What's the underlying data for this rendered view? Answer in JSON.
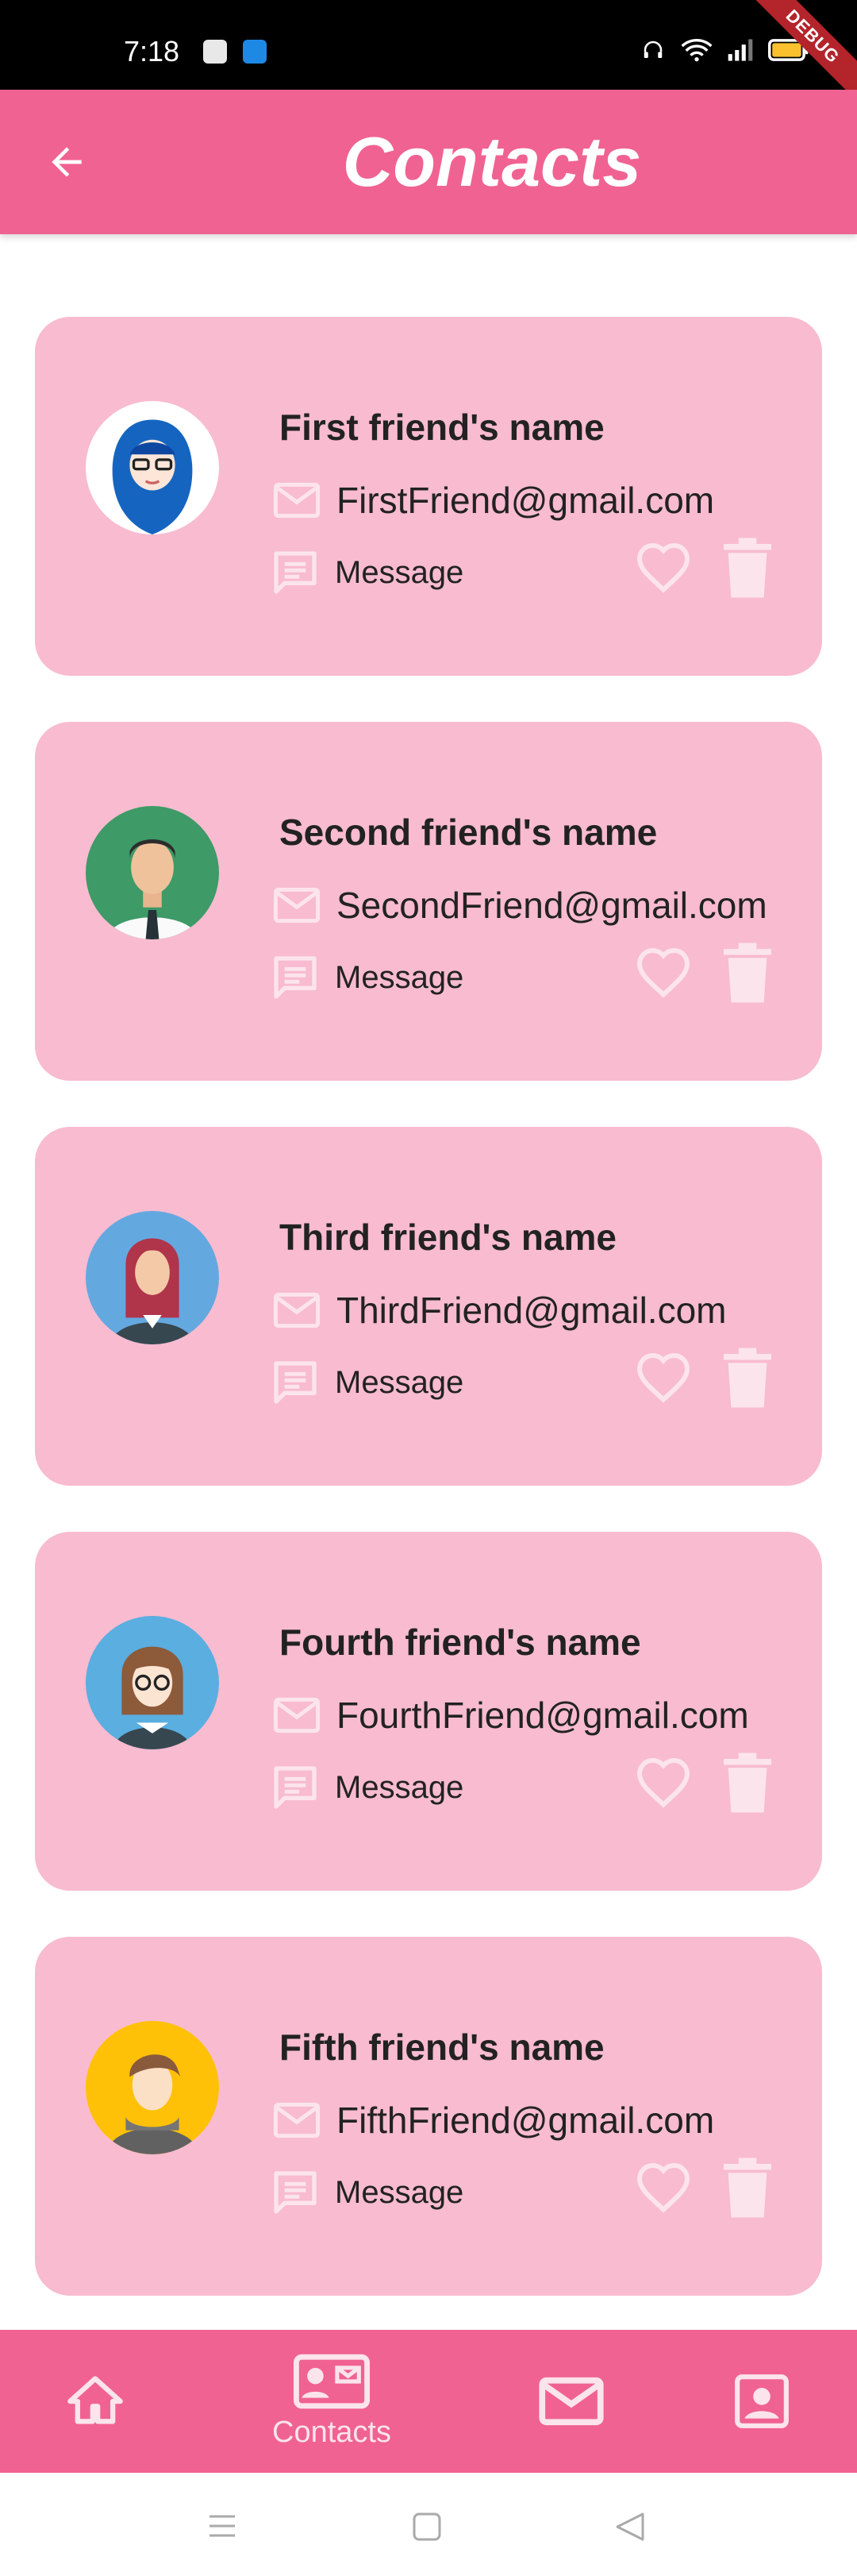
{
  "status_bar": {
    "time": "7:18",
    "debug_label": "DEBUG"
  },
  "app_bar": {
    "title": "Contacts"
  },
  "contacts": [
    {
      "name": "First friend's name",
      "email": "FirstFriend@gmail.com",
      "message_label": "Message",
      "avatar": "hijab-woman-avatar"
    },
    {
      "name": "Second friend's name",
      "email": "SecondFriend@gmail.com",
      "message_label": "Message",
      "avatar": "man-tie-avatar"
    },
    {
      "name": "Third friend's name",
      "email": "ThirdFriend@gmail.com",
      "message_label": "Message",
      "avatar": "red-hair-woman-avatar"
    },
    {
      "name": "Fourth friend's name",
      "email": "FourthFriend@gmail.com",
      "message_label": "Message",
      "avatar": "glasses-woman-avatar"
    },
    {
      "name": "Fifth friend's name",
      "email": "FifthFriend@gmail.com",
      "message_label": "Message",
      "avatar": "hoodie-man-avatar"
    }
  ],
  "bottom_nav": {
    "active_label": "Contacts"
  },
  "colors": {
    "primary": "#f06292",
    "card": "#f8bbd0",
    "icon_light": "#fce4ec"
  }
}
